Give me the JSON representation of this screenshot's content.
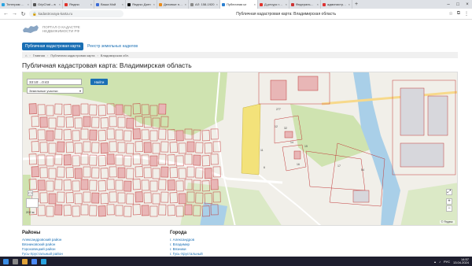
{
  "browser": {
    "tabs": [
      {
        "label": "Телеграм САВ",
        "color": "#2aa3e0"
      },
      {
        "label": "GripChat – в",
        "color": "#555"
      },
      {
        "label": "Яндекс",
        "color": "#e0322a"
      },
      {
        "label": "Ваша Мой",
        "color": "#3c6bd6"
      },
      {
        "label": "Яндекс Дзен",
        "color": "#111"
      },
      {
        "label": "Деловые новос",
        "color": "#e88a1a"
      },
      {
        "label": "АЛ: 158-1920",
        "color": "#888"
      },
      {
        "label": "Публичная ка",
        "color": "#2a7fd0",
        "active": true
      },
      {
        "label": "Д-ресурс город",
        "color": "#e0322a"
      },
      {
        "label": "Федеральный",
        "color": "#c33"
      },
      {
        "label": "администрация",
        "color": "#d33"
      }
    ],
    "url": "kadastrovaya-karta.ru",
    "page_title": "Публичная кадастровая карта: Владимирская область"
  },
  "site": {
    "logo_line1": "Портал о кадастре",
    "logo_line2": "недвижимости РФ",
    "nav_active": "Публичная кадастровая карта",
    "nav_link": "Реестр земельных наделов",
    "breadcrumb": [
      "Главная",
      "Публичная кадастровая карта",
      "Владимирская обл."
    ],
    "title": "Публичная кадастровая карта: Владимирская область"
  },
  "map": {
    "search_value": "33:10:...0:43",
    "find_label": "Найти",
    "layer_select": "Земельные участки",
    "attribution": "© Яндекс",
    "scale": "200 м",
    "parcel_labels": [
      "277",
      "12",
      "32",
      "14",
      "15",
      "11",
      "16",
      "6",
      "17",
      "54"
    ]
  },
  "lists": {
    "districts_title": "Районы",
    "districts": [
      "Александровский район",
      "Вязниковский район",
      "Гороховецкий район",
      "Гусь-Хрустальный район"
    ],
    "cities_title": "Города",
    "cities": [
      "г. Александров",
      "г. Владимир",
      "г. Вязники",
      "г. Гусь-Хрустальный"
    ]
  },
  "taskbar": {
    "time": "14:57",
    "date": "13.04.2024",
    "lang": "РУС"
  }
}
